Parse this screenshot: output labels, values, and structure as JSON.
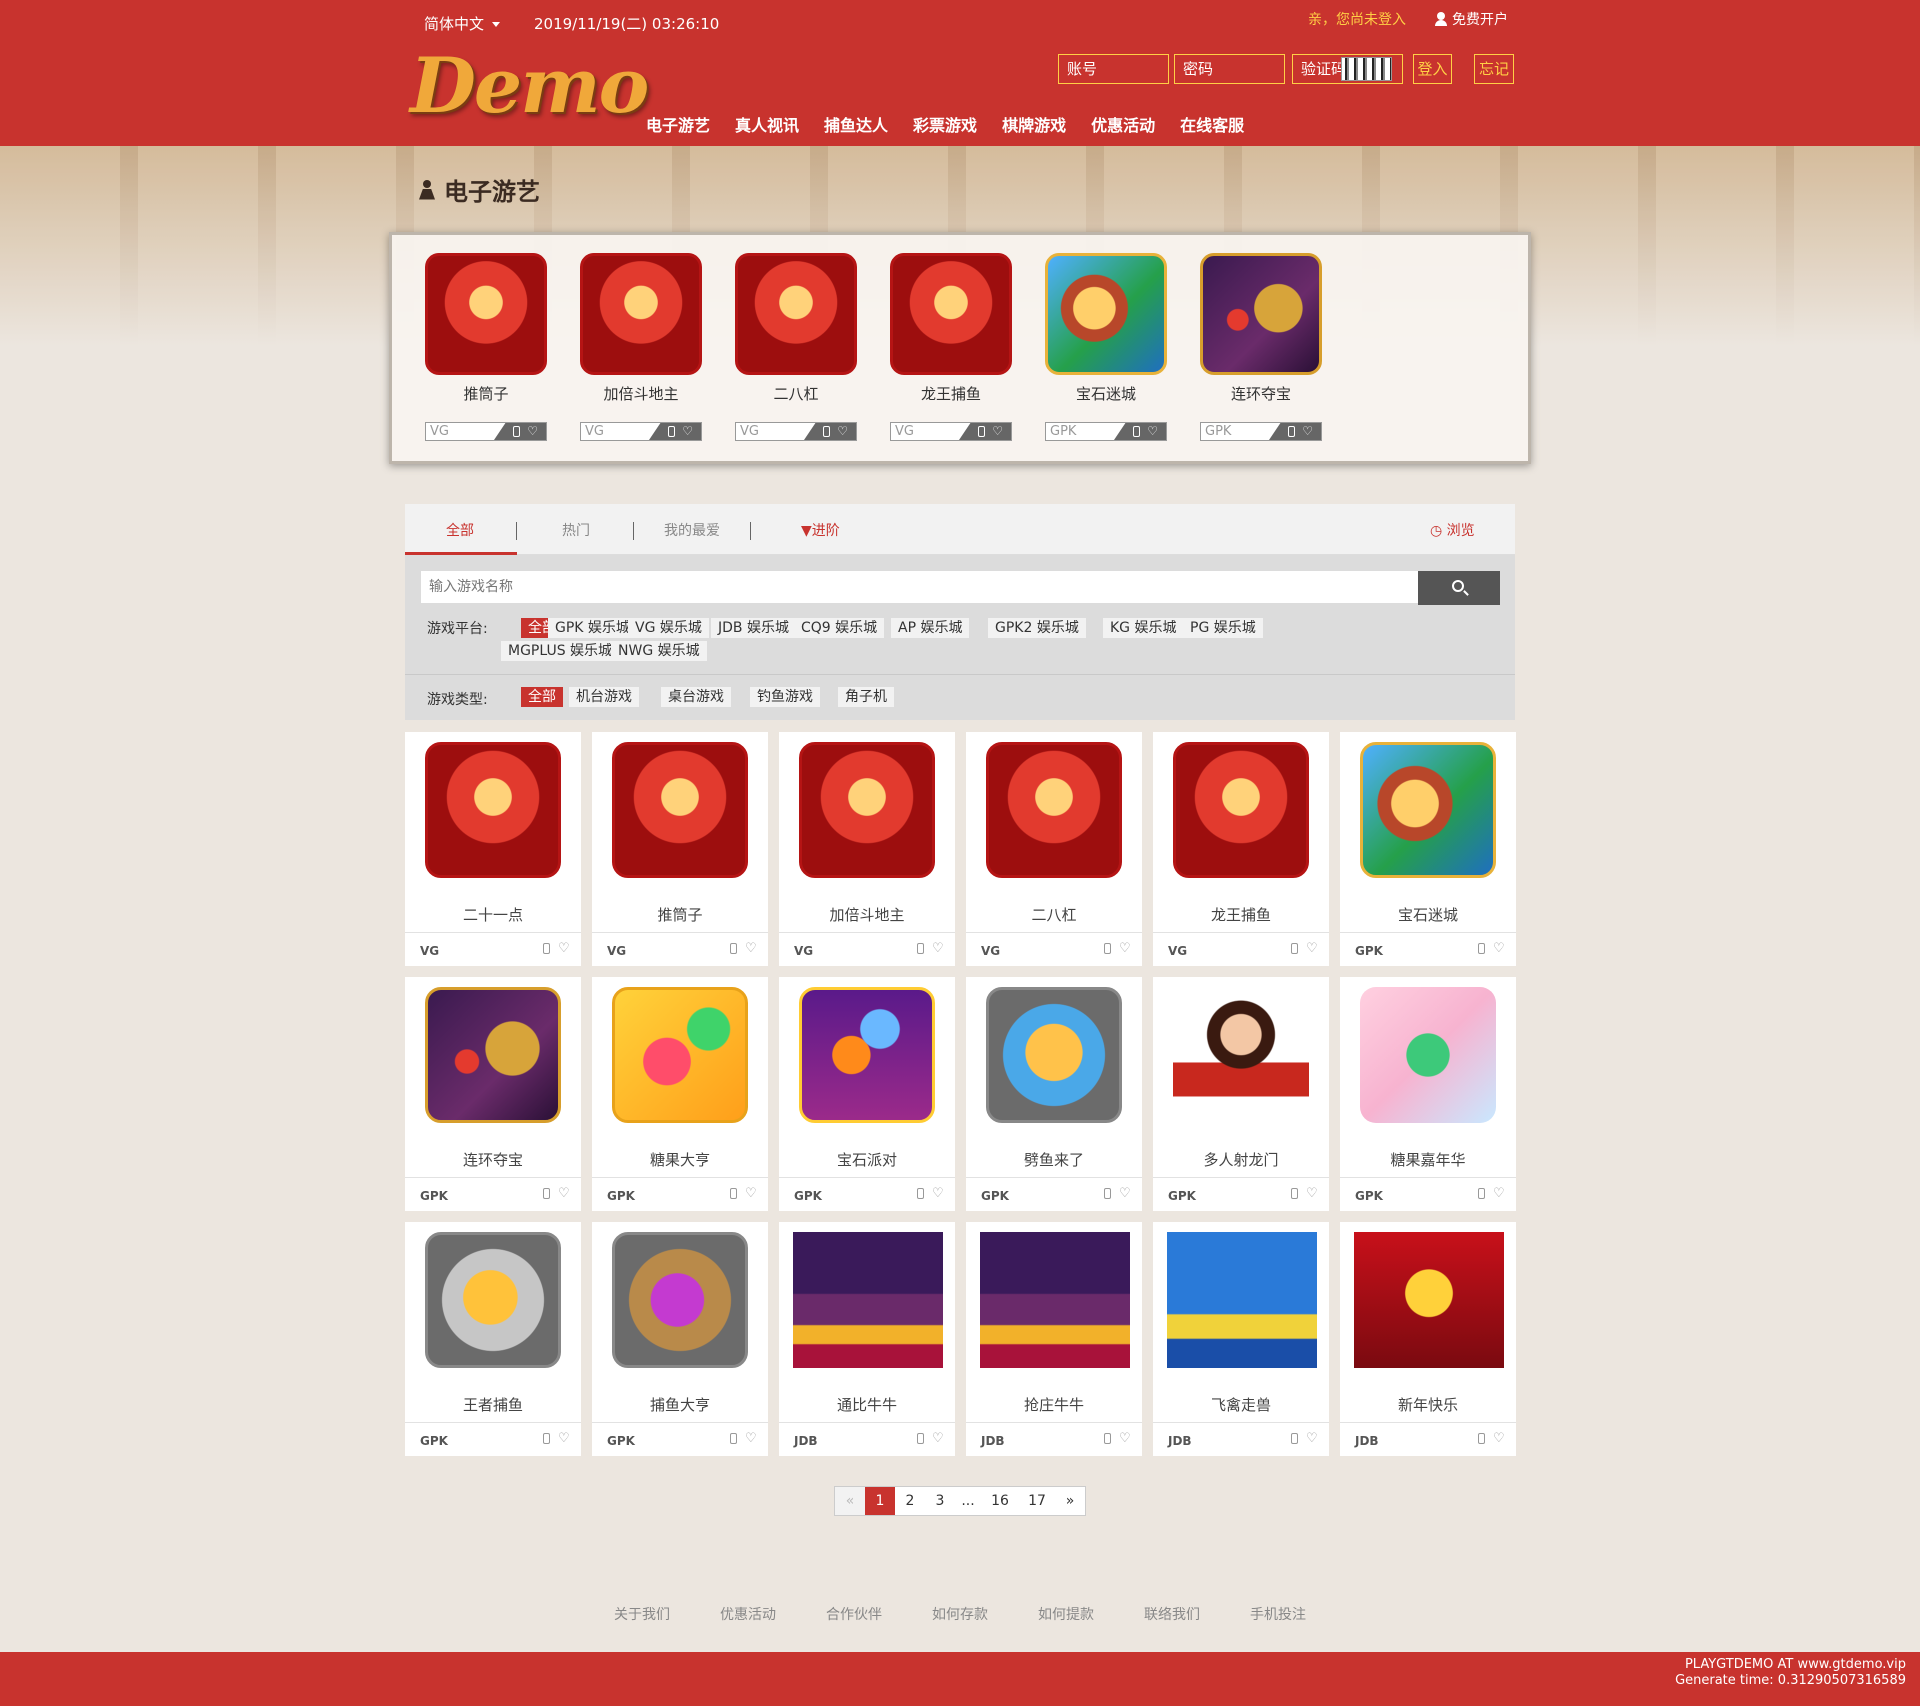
{
  "header": {
    "language": "简体中文",
    "datetime": "2019/11/19(二) 03:26:10",
    "not_logged_in": "亲，您尚未登入",
    "register": "免费开户",
    "account_placeholder": "账号",
    "password_placeholder": "密码",
    "captcha_placeholder": "验证码",
    "login": "登入",
    "forgot": "忘记",
    "logo": "Demo",
    "nav": [
      "电子游艺",
      "真人视讯",
      "捕鱼达人",
      "彩票游戏",
      "棋牌游戏",
      "优惠活动",
      "在线客服"
    ]
  },
  "page_title": "电子游艺",
  "featured": [
    {
      "name": "推筒子",
      "platform": "VG",
      "icon": "casino-icon"
    },
    {
      "name": "加倍斗地主",
      "platform": "VG",
      "icon": "casino-icon"
    },
    {
      "name": "二八杠",
      "platform": "VG",
      "icon": "casino-icon"
    },
    {
      "name": "龙王捕鱼",
      "platform": "VG",
      "icon": "casino-icon"
    },
    {
      "name": "宝石迷城",
      "platform": "GPK",
      "icon": "gem-city-icon"
    },
    {
      "name": "连环夺宝",
      "platform": "GPK",
      "icon": "dragon-treasure-icon"
    }
  ],
  "tabs": {
    "all": "全部",
    "hot": "热门",
    "favorites": "我的最爱",
    "advanced": "进阶",
    "browse": "浏览"
  },
  "search": {
    "placeholder": "输入游戏名称"
  },
  "filters": {
    "platform_label": "游戏平台:",
    "platforms": [
      "全部",
      "GPK 娱乐城",
      "VG 娱乐城",
      "JDB 娱乐城",
      "CQ9 娱乐城",
      "AP 娱乐城",
      "GPK2 娱乐城",
      "KG 娱乐城",
      "PG 娱乐城",
      "MGPLUS 娱乐城",
      "NWG 娱乐城"
    ],
    "type_label": "游戏类型:",
    "types": [
      "全部",
      "机台游戏",
      "桌台游戏",
      "钓鱼游戏",
      "角子机"
    ]
  },
  "games": [
    {
      "name": "二十一点",
      "platform": "VG",
      "icon": "casino-icon"
    },
    {
      "name": "推筒子",
      "platform": "VG",
      "icon": "casino-icon"
    },
    {
      "name": "加倍斗地主",
      "platform": "VG",
      "icon": "casino-icon"
    },
    {
      "name": "二八杠",
      "platform": "VG",
      "icon": "casino-icon"
    },
    {
      "name": "龙王捕鱼",
      "platform": "VG",
      "icon": "casino-icon"
    },
    {
      "name": "宝石迷城",
      "platform": "GPK",
      "icon": "gem-city-icon"
    },
    {
      "name": "连环夺宝",
      "platform": "GPK",
      "icon": "dragon-treasure-icon"
    },
    {
      "name": "糖果大亨",
      "platform": "GPK",
      "icon": "candy-icon"
    },
    {
      "name": "宝石派对",
      "platform": "GPK",
      "icon": "gem-party-icon"
    },
    {
      "name": "劈鱼来了",
      "platform": "GPK",
      "icon": "fish-icon"
    },
    {
      "name": "多人射龙门",
      "platform": "GPK",
      "icon": "lady-icon"
    },
    {
      "name": "糖果嘉年华",
      "platform": "GPK",
      "icon": "candy-carnival-icon"
    },
    {
      "name": "王者捕鱼",
      "platform": "GPK",
      "icon": "golden-fish-icon"
    },
    {
      "name": "捕鱼大亨",
      "platform": "GPK",
      "icon": "pirate-fish-icon"
    },
    {
      "name": "通比牛牛",
      "platform": "JDB",
      "icon": "niuniu-icon"
    },
    {
      "name": "抢庄牛牛",
      "platform": "JDB",
      "icon": "niuniu-icon"
    },
    {
      "name": "飞禽走兽",
      "platform": "JDB",
      "icon": "birds-beasts-icon"
    },
    {
      "name": "新年快乐",
      "platform": "JDB",
      "icon": "new-year-icon"
    }
  ],
  "pagination": [
    "«",
    "1",
    "2",
    "3",
    "...",
    "16",
    "17",
    "»"
  ],
  "current_page": "1",
  "footer": {
    "links": [
      "关于我们",
      "优惠活动",
      "合作伙伴",
      "如何存款",
      "如何提款",
      "联络我们",
      "手机投注"
    ],
    "line1": "PLAYGTDEMO AT www.gtdemo.vip",
    "line2": "Generate time: 0.31290507316589"
  },
  "colors": {
    "brand": "#c8332e",
    "accent": "#ffcf45"
  }
}
